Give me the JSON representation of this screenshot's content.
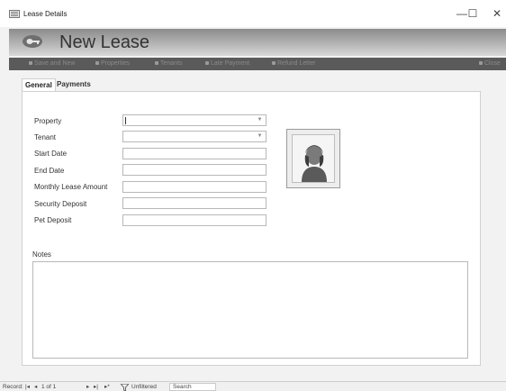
{
  "window": {
    "title": "Lease Details",
    "minimize_glyph": "—",
    "maximize_glyph": "☐",
    "close_glyph": "✕"
  },
  "header": {
    "form_title": "New Lease",
    "form_icon": "key-icon"
  },
  "commands": [
    {
      "label": "Save and New"
    },
    {
      "label": "Properties"
    },
    {
      "label": "Tenants"
    },
    {
      "label": "Late Payment"
    },
    {
      "label": "Refund Letter"
    },
    {
      "label": "Close"
    }
  ],
  "tabs": [
    {
      "label": "General",
      "active": true
    },
    {
      "label": "Payments",
      "active": false
    }
  ],
  "fields": {
    "property": {
      "label": "Property",
      "value": ""
    },
    "tenant": {
      "label": "Tenant",
      "value": ""
    },
    "start_date": {
      "label": "Start Date",
      "value": ""
    },
    "end_date": {
      "label": "End Date",
      "value": ""
    },
    "monthly_lease_amount": {
      "label": "Monthly Lease Amount",
      "value": ""
    },
    "security_deposit": {
      "label": "Security Deposit",
      "value": ""
    },
    "pet_deposit": {
      "label": "Pet Deposit",
      "value": ""
    }
  },
  "notes": {
    "label": "Notes",
    "value": ""
  },
  "record_nav": {
    "record_label": "Record:",
    "first": "|◂",
    "prev": "◂",
    "position": "1 of 1",
    "next": "▸",
    "last": "▸|",
    "new": "▸*",
    "filter_status": "Unfiltered",
    "search_placeholder": "Search"
  },
  "colors": {
    "header_band": "#a0a0a0",
    "command_strip": "#5a5a5a",
    "window_bg": "#f2f2f2"
  }
}
